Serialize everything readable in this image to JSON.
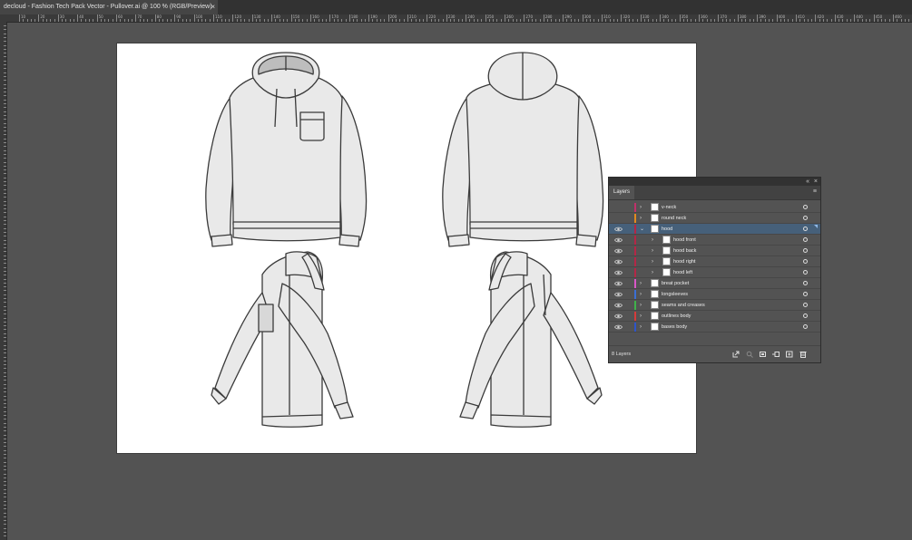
{
  "document": {
    "tab_title": "decloud - Fashion Tech Pack Vector - Pullover.ai @ 100 % (RGB/Preview)",
    "close_glyph": "×"
  },
  "ruler": {
    "top_labels": [
      "10",
      "20",
      "30",
      "40",
      "50",
      "60",
      "70",
      "80",
      "90",
      "100",
      "110",
      "120",
      "130",
      "140",
      "150",
      "160",
      "170",
      "180",
      "190",
      "200",
      "210",
      "220",
      "230",
      "240",
      "250",
      "260",
      "270",
      "280",
      "290",
      "300",
      "310",
      "320",
      "330",
      "340",
      "350",
      "360",
      "370",
      "380",
      "390",
      "400",
      "410",
      "420",
      "430",
      "440",
      "450",
      "460"
    ]
  },
  "layers_panel": {
    "tab_label": "Layers",
    "collapse_glyph": "«",
    "close_glyph": "×",
    "menu_glyph": "≡",
    "layer_count": "8 Layers",
    "layers": [
      {
        "name": "v-neck",
        "color": "#c0306a",
        "visible": false,
        "indent": 0,
        "expanded": false,
        "selected": false
      },
      {
        "name": "round neck",
        "color": "#e08a1e",
        "visible": false,
        "indent": 0,
        "expanded": false,
        "selected": false
      },
      {
        "name": "hood",
        "color": "#b32746",
        "visible": true,
        "indent": 0,
        "expanded": true,
        "selected": true
      },
      {
        "name": "hood front",
        "color": "#b32746",
        "visible": true,
        "indent": 1,
        "expanded": false,
        "selected": false
      },
      {
        "name": "hood back",
        "color": "#b32746",
        "visible": true,
        "indent": 1,
        "expanded": false,
        "selected": false
      },
      {
        "name": "hood right",
        "color": "#b32746",
        "visible": true,
        "indent": 1,
        "expanded": false,
        "selected": false
      },
      {
        "name": "hood left",
        "color": "#b32746",
        "visible": true,
        "indent": 1,
        "expanded": false,
        "selected": false
      },
      {
        "name": "breat pocket",
        "color": "#d957c8",
        "visible": true,
        "indent": 0,
        "expanded": false,
        "selected": false
      },
      {
        "name": "longsleeves",
        "color": "#3b6fd4",
        "visible": true,
        "indent": 0,
        "expanded": false,
        "selected": false
      },
      {
        "name": "seams and creases",
        "color": "#3fb24a",
        "visible": true,
        "indent": 0,
        "expanded": false,
        "selected": false
      },
      {
        "name": "outlines body",
        "color": "#d63b3b",
        "visible": true,
        "indent": 0,
        "expanded": false,
        "selected": false
      },
      {
        "name": "bases body",
        "color": "#2f55c9",
        "visible": true,
        "indent": 0,
        "expanded": false,
        "selected": false
      }
    ],
    "footer_icons": [
      "export-icon",
      "search-icon",
      "clipping-mask-icon",
      "new-sublayer-icon",
      "new-layer-icon",
      "delete-icon"
    ]
  },
  "colors": {
    "app_bg": "#535353",
    "garment_fill": "#e9e9e9",
    "garment_stroke": "#3a3a3a",
    "selection": "#46607a"
  }
}
